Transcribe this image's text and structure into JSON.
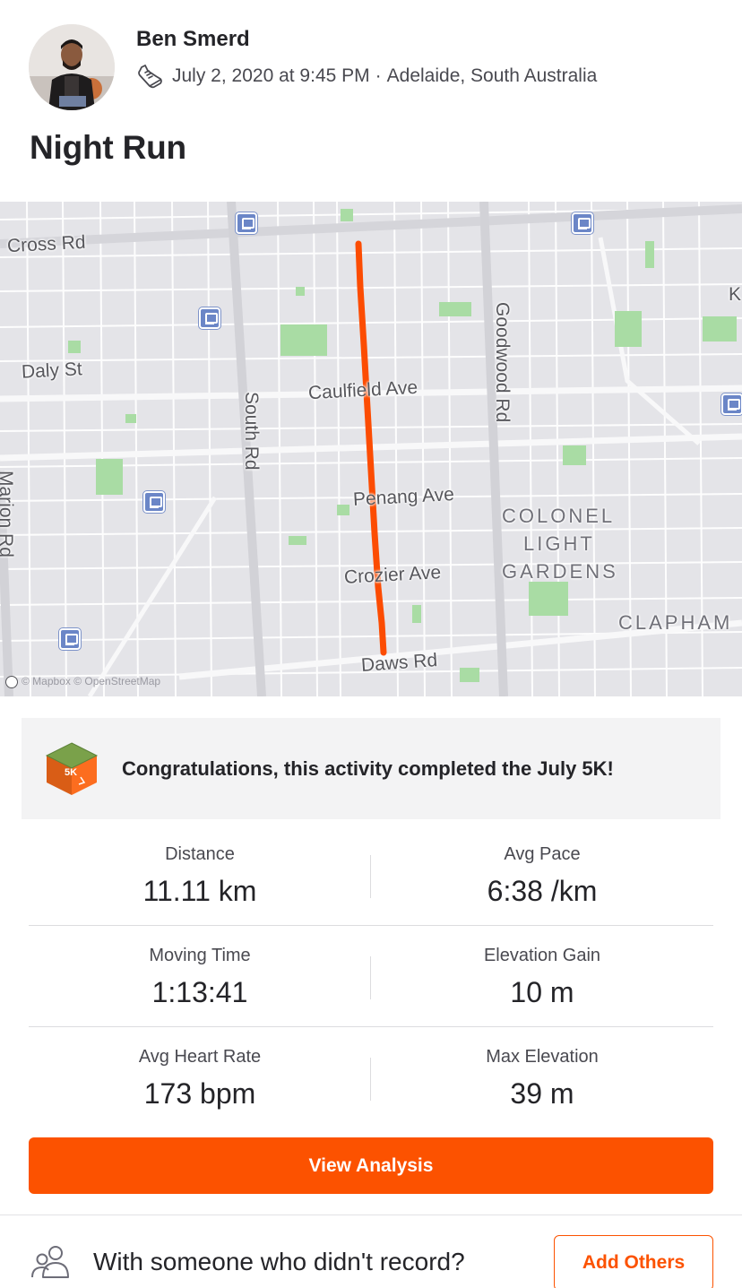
{
  "athlete": {
    "name": "Ben Smerd",
    "date_time": "July 2, 2020 at 9:45 PM",
    "separator": "·",
    "location": "Adelaide, South Australia",
    "activity_icon": "running-shoe-icon"
  },
  "activity": {
    "title": "Night Run"
  },
  "map": {
    "streets": [
      "Cross Rd",
      "Daly St",
      "Caulfield Ave",
      "South Rd",
      "Goodwood Rd",
      "Penang Ave",
      "Crozier Ave",
      "Daws Rd",
      "Marion Rd",
      "K"
    ],
    "areas": [
      "COLONEL",
      "LIGHT",
      "GARDENS",
      "CLAPHAM"
    ],
    "attribution": "© Mapbox © OpenStreetMap",
    "route_color": "#fc4c02"
  },
  "challenge": {
    "badge_label": "5K",
    "message": "Congratulations, this activity completed the July 5K!"
  },
  "stats": [
    {
      "left_label": "Distance",
      "left_value": "11.11 km",
      "right_label": "Avg Pace",
      "right_value": "6:38 /km"
    },
    {
      "left_label": "Moving Time",
      "left_value": "1:13:41",
      "right_label": "Elevation Gain",
      "right_value": "10 m"
    },
    {
      "left_label": "Avg Heart Rate",
      "left_value": "173 bpm",
      "right_label": "Max Elevation",
      "right_value": "39 m"
    }
  ],
  "actions": {
    "view_analysis": "View Analysis",
    "with_prompt": "With someone who didn't record?",
    "add_others": "Add Others"
  },
  "colors": {
    "brand": "#fc5200",
    "text": "#242428",
    "muted": "#494950"
  }
}
